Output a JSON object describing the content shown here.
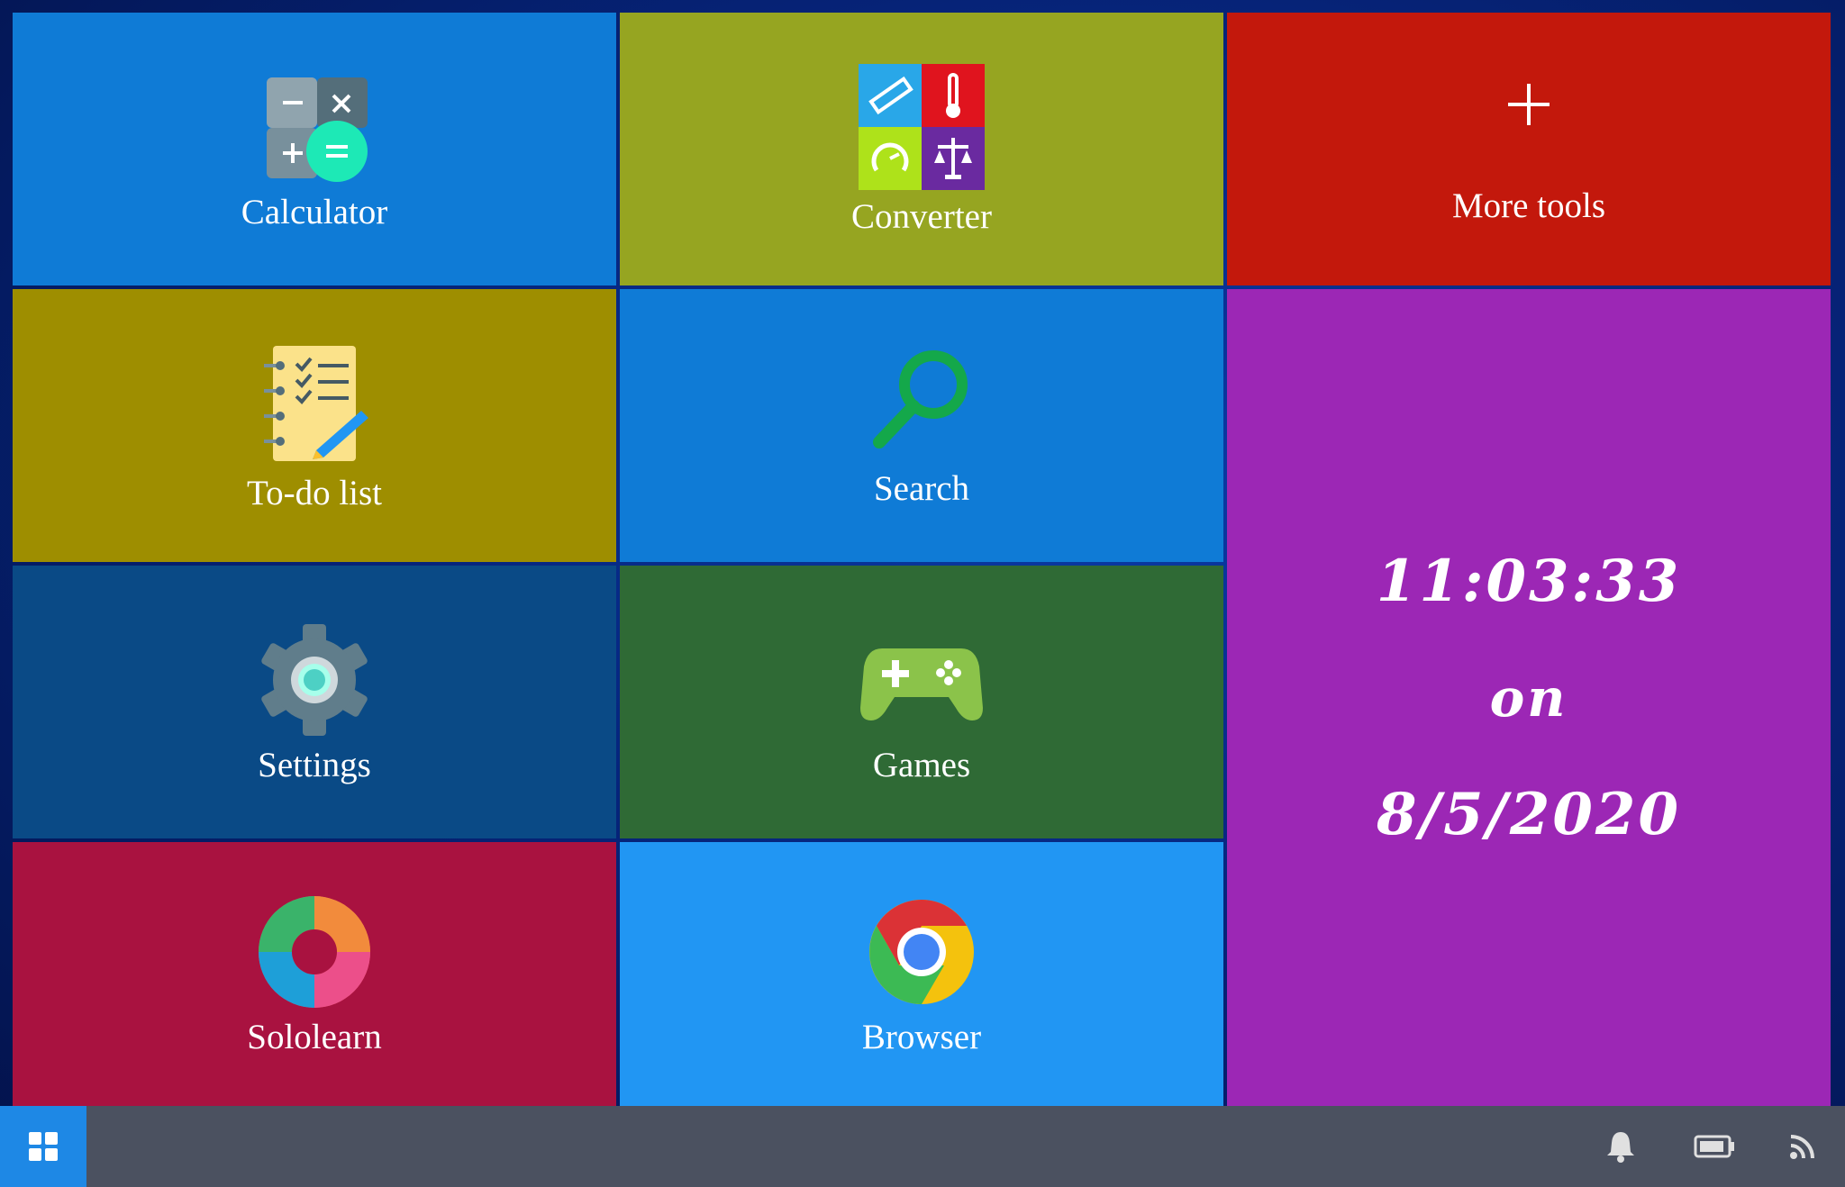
{
  "tiles": {
    "calculator": {
      "label": "Calculator",
      "color": "#0f7bd6"
    },
    "converter": {
      "label": "Converter",
      "color": "#96a521"
    },
    "more_tools": {
      "label": "More tools",
      "color": "#c3180c"
    },
    "todo": {
      "label": "To-do list",
      "color": "#9e8e00"
    },
    "search": {
      "label": "Search",
      "color": "#0f7bd6"
    },
    "settings": {
      "label": "Settings",
      "color": "#0a4a86"
    },
    "games": {
      "label": "Games",
      "color": "#2f6a35"
    },
    "sololearn": {
      "label": "Sololearn",
      "color": "#a91240"
    },
    "browser": {
      "label": "Browser",
      "color": "#2196f3"
    }
  },
  "clock": {
    "time": "11:03:33",
    "on": "on",
    "date": "8/5/2020",
    "color": "#9c27b5"
  },
  "taskbar": {
    "start_icon": "windows-grid-icon",
    "tray": [
      "bell-icon",
      "battery-icon",
      "rss-icon"
    ]
  }
}
